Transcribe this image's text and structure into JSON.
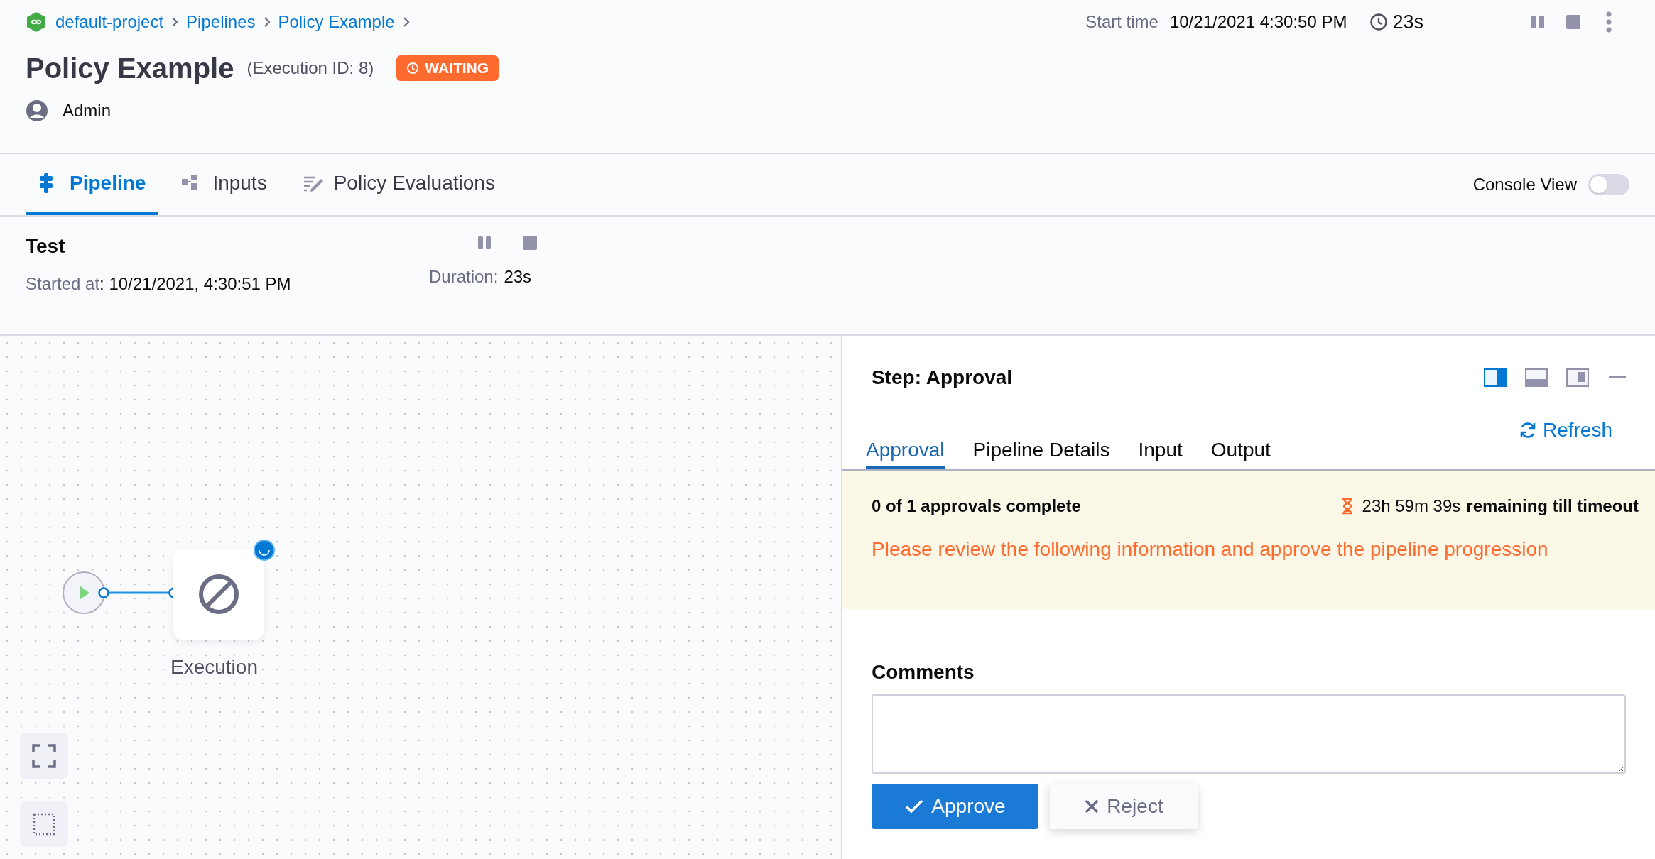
{
  "breadcrumbs": [
    "default-project",
    "Pipelines",
    "Policy Example"
  ],
  "header": {
    "title": "Policy Example",
    "execution_id": "(Execution ID: 8)",
    "status": "WAITING",
    "user": "Admin",
    "start_time_label": "Start time",
    "start_time": "10/21/2021 4:30:50 PM",
    "duration": "23s"
  },
  "tabs": [
    {
      "label": "Pipeline",
      "selected": true
    },
    {
      "label": "Inputs",
      "selected": false
    },
    {
      "label": "Policy Evaluations",
      "selected": false
    }
  ],
  "console_view": {
    "label": "Console View",
    "on": false
  },
  "stage": {
    "name": "Test",
    "started_label": "Started at",
    "started_value": ": 10/21/2021, 4:30:51 PM",
    "duration_label": "Duration:",
    "duration": "23s"
  },
  "canvas": {
    "node_label": "Execution"
  },
  "step_panel": {
    "title": "Step: Approval",
    "layout_options": [
      {
        "selected": true
      },
      {
        "selected": false
      },
      {
        "selected": false
      }
    ],
    "tabs": [
      {
        "label": "Approval",
        "selected": true
      },
      {
        "label": "Pipeline Details",
        "selected": false
      },
      {
        "label": "Input",
        "selected": false
      },
      {
        "label": "Output",
        "selected": false
      }
    ],
    "refresh": "Refresh",
    "approvals": "0 of 1 approvals complete",
    "remaining_time": "23h 59m 39s",
    "remaining_label": "remaining till timeout",
    "message": "Please review the following information and approve the pipeline progression",
    "comments_label": "Comments",
    "buttons": [
      {
        "kind": "approve",
        "label": "Approve"
      },
      {
        "kind": "reject",
        "label": "Reject"
      }
    ]
  }
}
